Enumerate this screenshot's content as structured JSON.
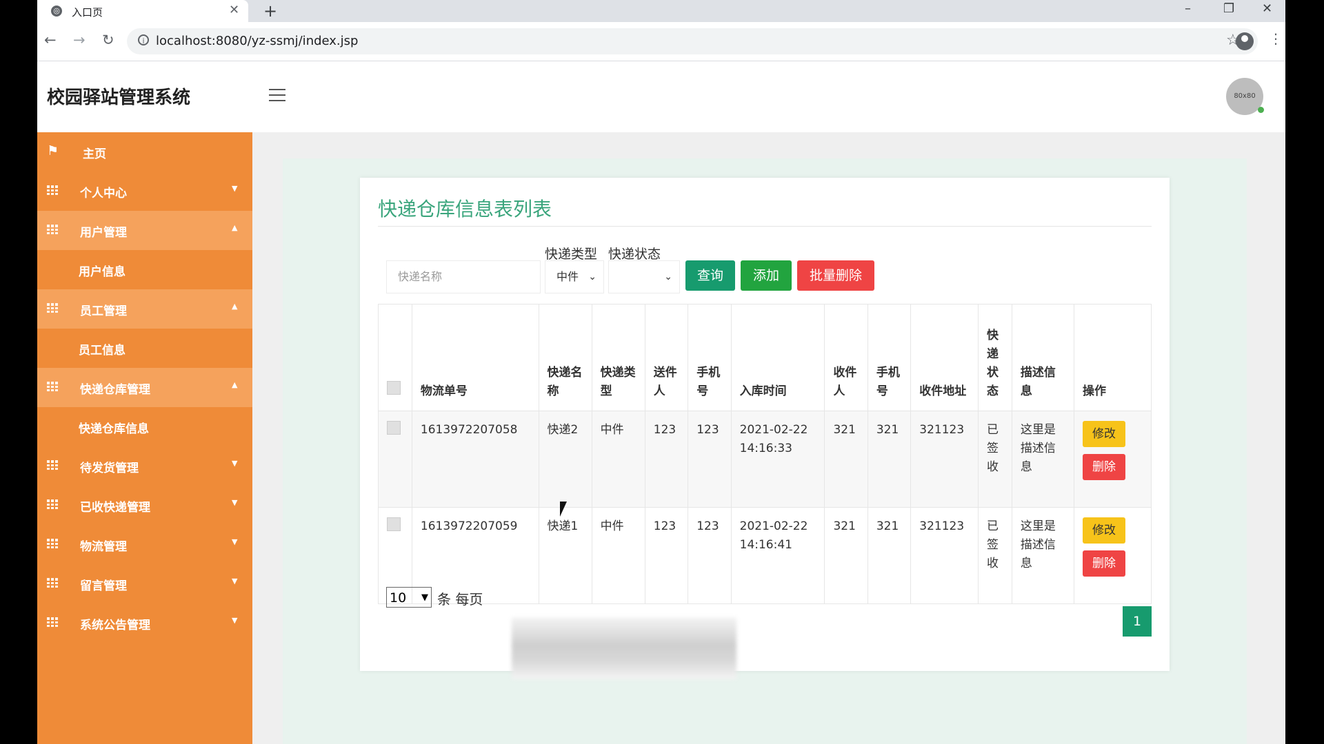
{
  "browser": {
    "tab_title": "入口页",
    "tab_close": "✕",
    "new_tab": "+",
    "url": "localhost:8080/yz-ssmj/index.jsp",
    "win_minimize": "–",
    "win_restore": "❐",
    "win_close": "✕"
  },
  "header": {
    "app_title": "校园驿站管理系统",
    "avatar_text": "80x80"
  },
  "sidebar": {
    "items": [
      {
        "label": "主页"
      },
      {
        "label": "个人中心"
      },
      {
        "label": "用户管理"
      },
      {
        "label": "用户信息"
      },
      {
        "label": "员工管理"
      },
      {
        "label": "员工信息"
      },
      {
        "label": "快递仓库管理"
      },
      {
        "label": "快递仓库信息"
      },
      {
        "label": "待发货管理"
      },
      {
        "label": "已收快递管理"
      },
      {
        "label": "物流管理"
      },
      {
        "label": "留言管理"
      },
      {
        "label": "系统公告管理"
      }
    ]
  },
  "main": {
    "title": "快递仓库信息表列表",
    "filter": {
      "type_label": "快递类型",
      "status_label": "快递状态",
      "name_placeholder": "快递名称",
      "type_value": "中件",
      "status_value": ""
    },
    "buttons": {
      "query": "查询",
      "add": "添加",
      "batch_delete": "批量删除"
    },
    "table": {
      "headers": [
        "物流单号",
        "快递名称",
        "快递类型",
        "送件人",
        "手机号",
        "入库时间",
        "收件人",
        "手机号",
        "收件地址",
        "快递状态",
        "描述信息",
        "操作"
      ],
      "rows": [
        {
          "tracking_no": "1613972207058",
          "name": "快递2",
          "type": "中件",
          "sender": "123",
          "sender_phone": "123",
          "in_time": "2021-02-22 14:16:33",
          "receiver": "321",
          "receiver_phone": "321",
          "address": "321123",
          "status": "已签收",
          "desc": "这里是描述信息",
          "edit": "修改",
          "delete": "删除"
        },
        {
          "tracking_no": "1613972207059",
          "name": "快递1",
          "type": "中件",
          "sender": "123",
          "sender_phone": "123",
          "in_time": "2021-02-22 14:16:41",
          "receiver": "321",
          "receiver_phone": "321",
          "address": "321123",
          "status": "已签收",
          "desc": "这里是描述信息",
          "edit": "修改",
          "delete": "删除"
        }
      ]
    },
    "pagination": {
      "page_size": "10",
      "page_size_label": "条 每页",
      "current_page": "1"
    }
  },
  "colors": {
    "sidebar": "#ef8b38",
    "accent_green": "#3aa57c",
    "query_button": "#179b6e",
    "add_button": "#22a43f",
    "delete_button": "#ef4444",
    "edit_button": "#f7c31a"
  }
}
